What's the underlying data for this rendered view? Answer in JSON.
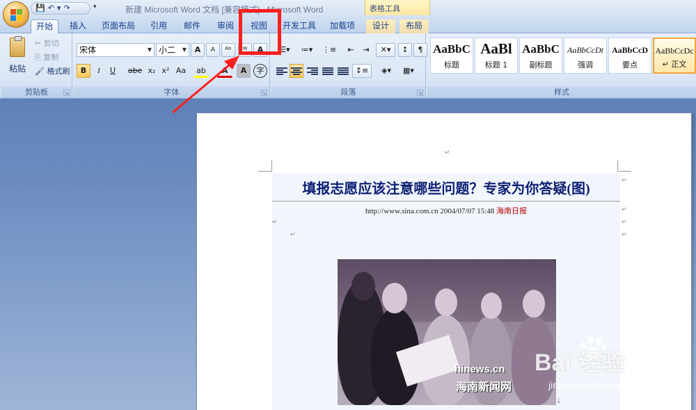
{
  "window": {
    "title": "新建 Microsoft Word 文档 [兼容模式] - Microsoft Word",
    "context_tools": "表格工具"
  },
  "quick_access": {
    "save": "💾",
    "undo": "↶",
    "undo_arrow": "▾",
    "redo": "↷",
    "more": "▾"
  },
  "tabs": [
    {
      "label": "开始"
    },
    {
      "label": "插入"
    },
    {
      "label": "页面布局"
    },
    {
      "label": "引用"
    },
    {
      "label": "邮件"
    },
    {
      "label": "审阅"
    },
    {
      "label": "视图"
    },
    {
      "label": "开发工具"
    },
    {
      "label": "加载项"
    },
    {
      "label": "设计"
    },
    {
      "label": "布局"
    }
  ],
  "clipboard": {
    "paste": "粘贴",
    "cut": "剪切",
    "copy": "复制",
    "format_painter": "格式刷",
    "group": "剪贴板"
  },
  "font": {
    "name": "宋体",
    "size": "小二",
    "group": "字体",
    "grow": "A",
    "shrink": "A",
    "clear": "A",
    "bold": "B",
    "italic": "I",
    "underline": "U",
    "strike": "abe",
    "sub": "x₂",
    "sup": "x²",
    "case": "Aa",
    "highlight": "ab",
    "color": "A",
    "shade": "A",
    "circle": "字"
  },
  "paragraph": {
    "group": "段落"
  },
  "styles": {
    "group": "样式",
    "items": [
      {
        "sample": "AaBbC",
        "name": "标题"
      },
      {
        "sample": "AaBl",
        "name": "标题 1"
      },
      {
        "sample": "AaBbC",
        "name": "副标题"
      },
      {
        "sample": "AaBbCcDt",
        "name": "强调"
      },
      {
        "sample": "AaBbCcD",
        "name": "要点"
      },
      {
        "sample": "AaBbCcDc",
        "name": "↵ 正文"
      }
    ]
  },
  "document": {
    "headline": "填报志愿应该注意哪些问题？专家为你答疑(图)",
    "meta_left": "http://www.sina.com.cn  2004/07/07 15:48  ",
    "meta_source": "海南日报",
    "photo_watermark_en": "hinews.cn",
    "photo_watermark_cn": "海南新闻网",
    "para_mark": "↵"
  },
  "watermark": {
    "text": "Bai 经验",
    "url": "jingyan.baidu.com"
  },
  "colors": {
    "annotation": "#ff1f1f",
    "ribbon_text": "#15428b",
    "headline": "#0b1f73"
  }
}
